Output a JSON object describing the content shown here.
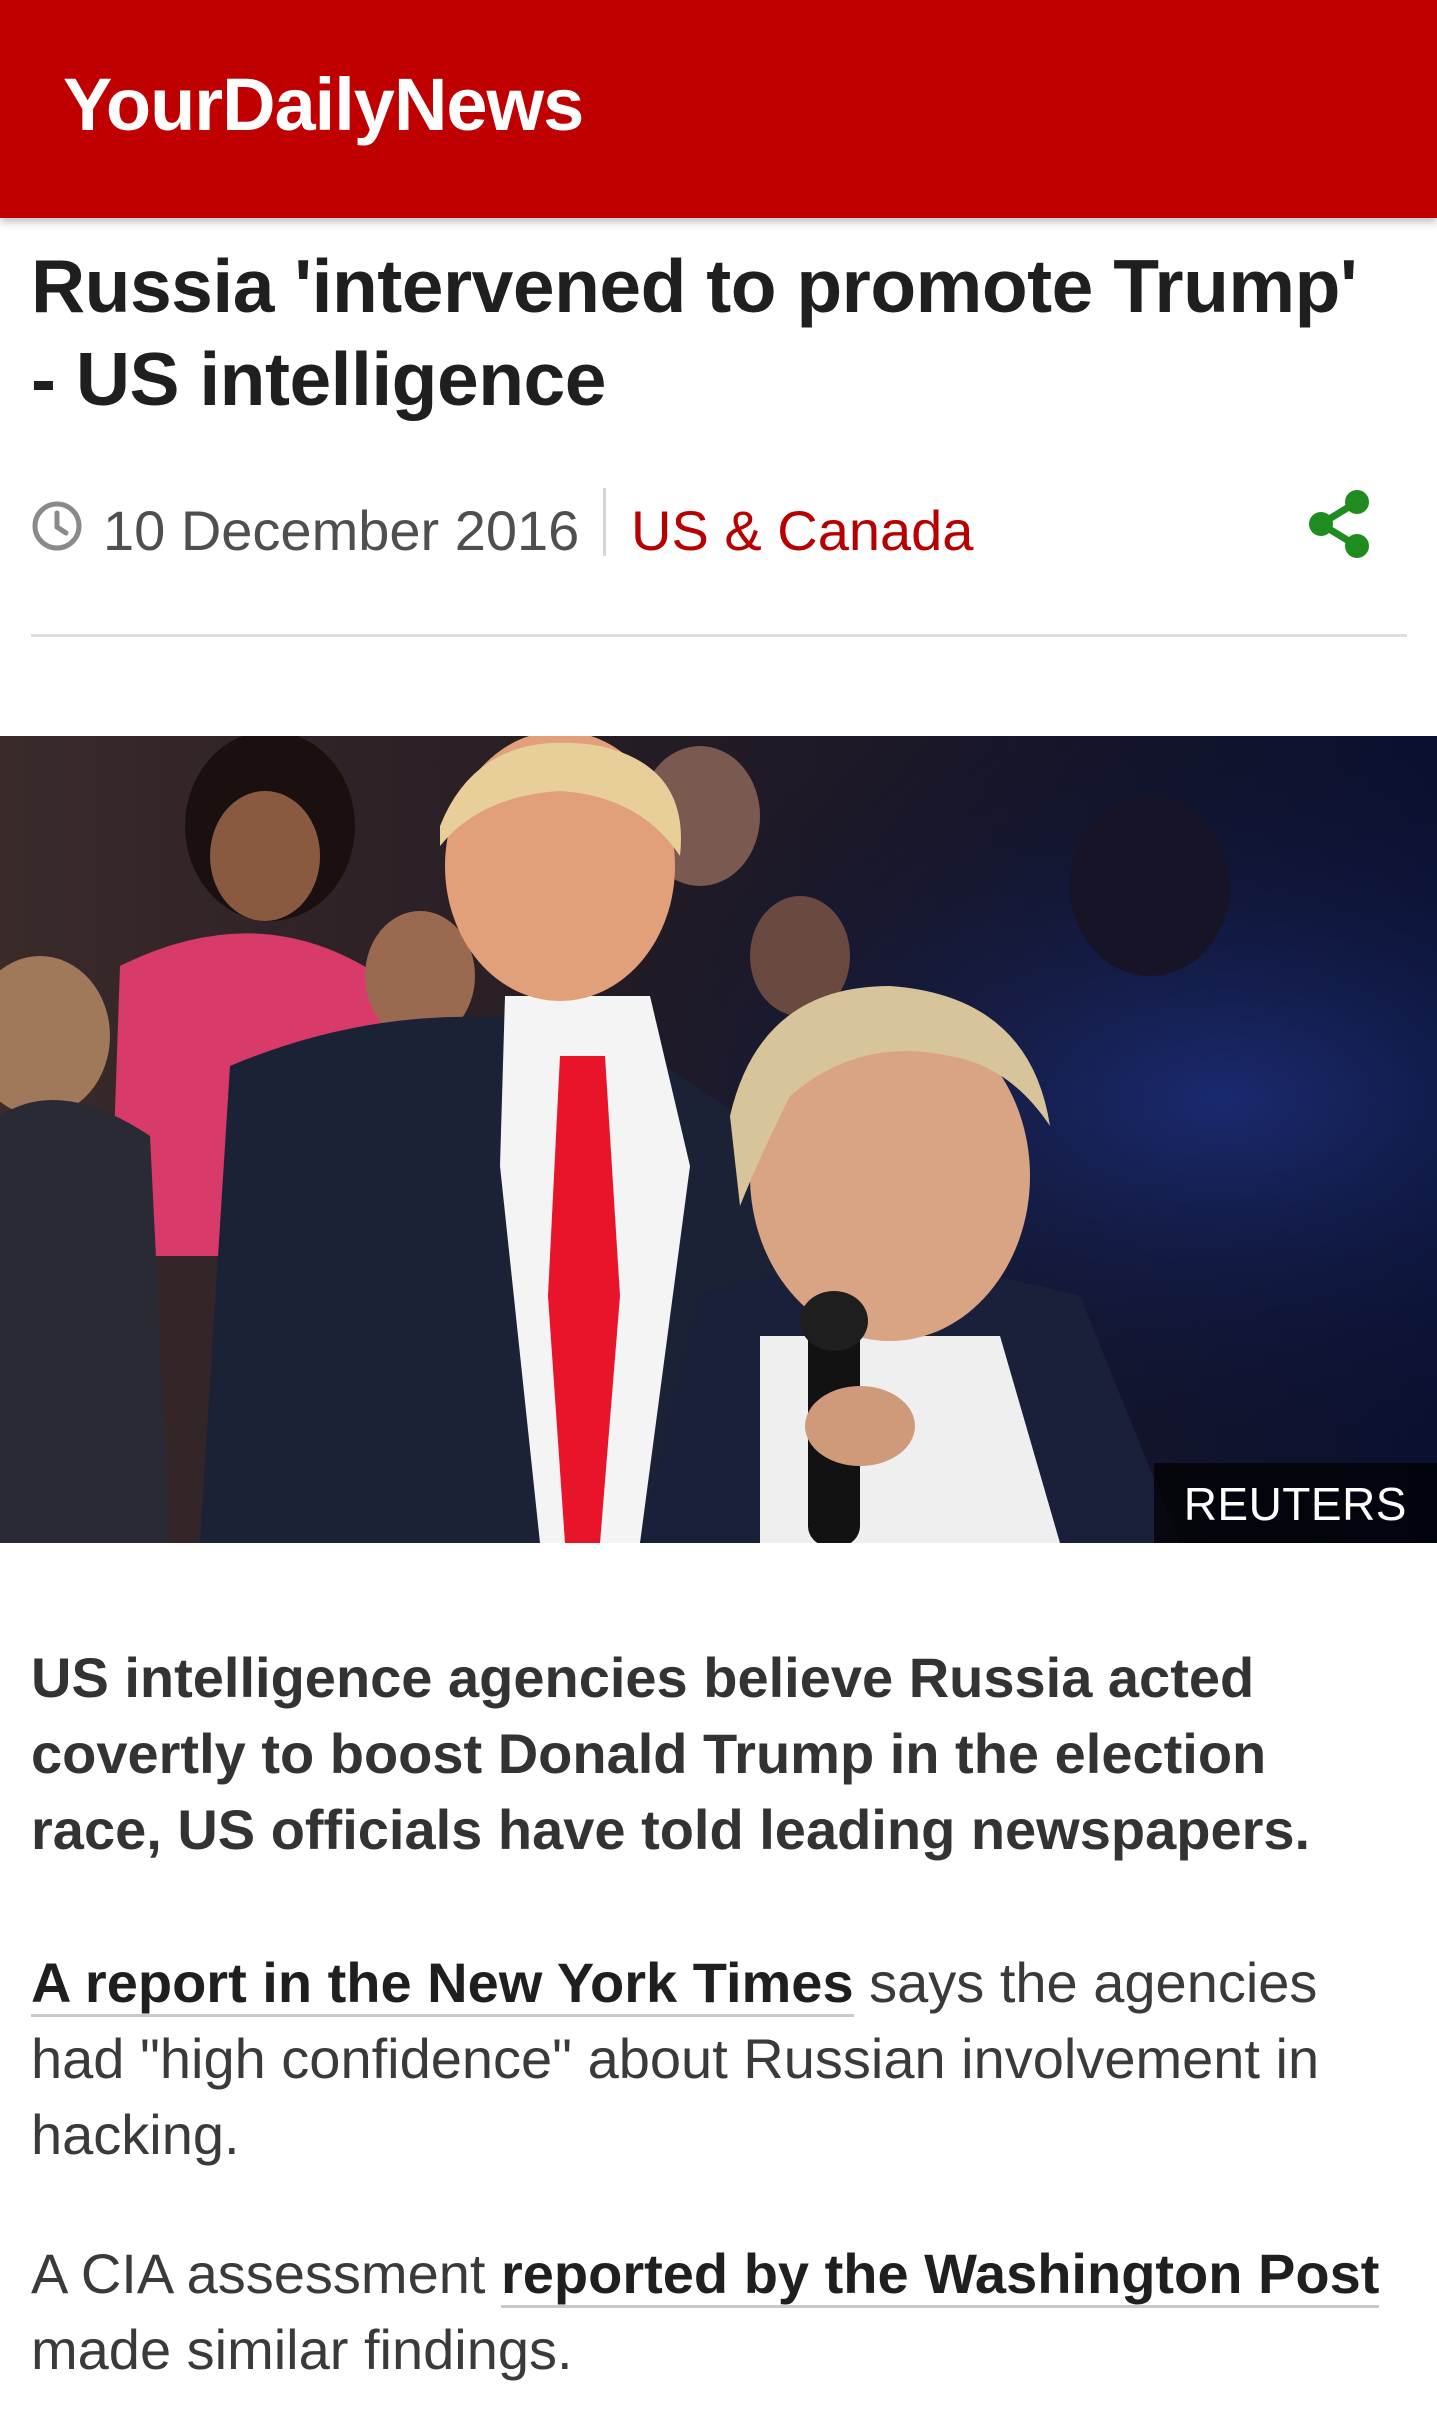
{
  "app": {
    "title": "YourDailyNews",
    "brand_color": "#c00000"
  },
  "article": {
    "headline": "Russia 'intervened to promote Trump' - US intelligence",
    "date": "10 December 2016",
    "category": "US & Canada",
    "category_color": "#b80000",
    "share_icon": "share-icon",
    "share_icon_color": "#1e8c1e",
    "image": {
      "description_icon": "photo",
      "credit": "REUTERS"
    },
    "summary": "US intelligence agencies believe Russia acted covertly to boost Donald Trump in the election race, US officials have told leading newspapers.",
    "paragraph1": {
      "link": "A report in the New York Times",
      "text": " says the agencies had \"high confidence\" about Russian involvement in hacking."
    },
    "paragraph2": {
      "before": "A CIA assessment ",
      "link": "reported by the Washington Post",
      "after": " made similar findings."
    }
  }
}
